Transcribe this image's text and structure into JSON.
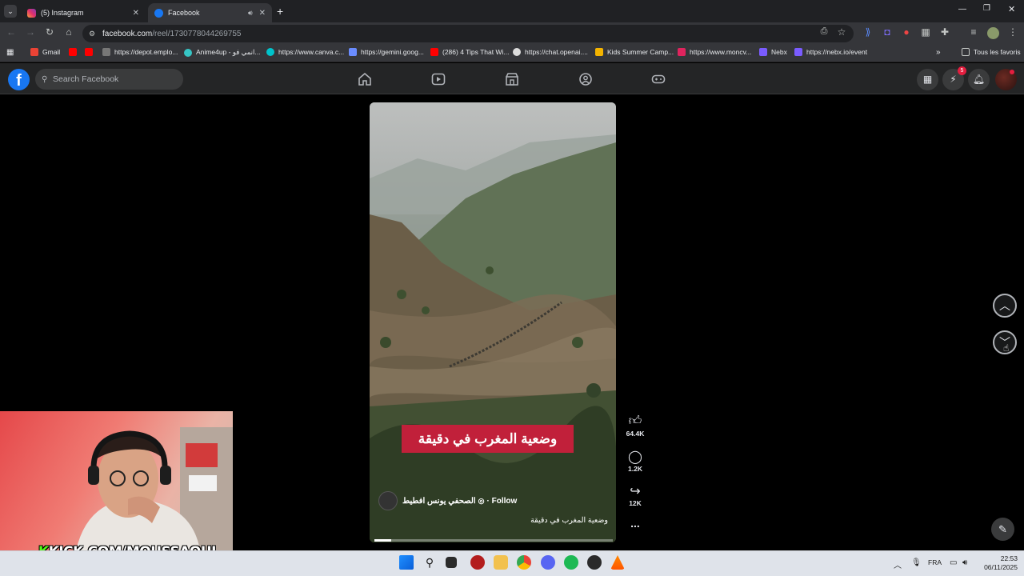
{
  "browser": {
    "tabs": [
      {
        "title": "(5) Instagram",
        "active": false
      },
      {
        "title": "Facebook",
        "active": true
      }
    ],
    "url_host": "facebook.com",
    "url_path": "/reel/1730778044269755",
    "bookmarks": [
      {
        "label": "Gmail"
      },
      {
        "label": "https://depot.emplo..."
      },
      {
        "label": "Anime4up - انمي فو..."
      },
      {
        "label": "https://www.canva.c..."
      },
      {
        "label": "https://gemini.goog..."
      },
      {
        "label": "(286) 4 Tips That Wi..."
      },
      {
        "label": "https://chat.openai...."
      },
      {
        "label": "Kids Summer Camp..."
      },
      {
        "label": "https://www.moncv..."
      },
      {
        "label": "Nebx"
      },
      {
        "label": "https://nebx.io/event"
      }
    ],
    "all_bookmarks_label": "Tous les favoris"
  },
  "facebook": {
    "search_placeholder": "Search Facebook",
    "messenger_badge": "5",
    "reel": {
      "overlay_text": "وضعية المغرب في دقيقة",
      "author": "الصحفي يونس افطيط",
      "follow_label": "· Follow",
      "description": "وضعية المغرب في دقيقة",
      "likes": "64.4K",
      "comments": "1.2K",
      "shares": "12K",
      "more": "...",
      "progress_fraction": 0.07
    }
  },
  "stream": {
    "overlay_text": "KICK.COM/MOUSSAOUI"
  },
  "taskbar": {
    "language": "FRA",
    "time": "22:53",
    "date": "06/11/2025"
  },
  "colors": {
    "facebook_blue": "#1877f2",
    "caption_red": "#c1203a",
    "kick_green": "#53fc18"
  }
}
